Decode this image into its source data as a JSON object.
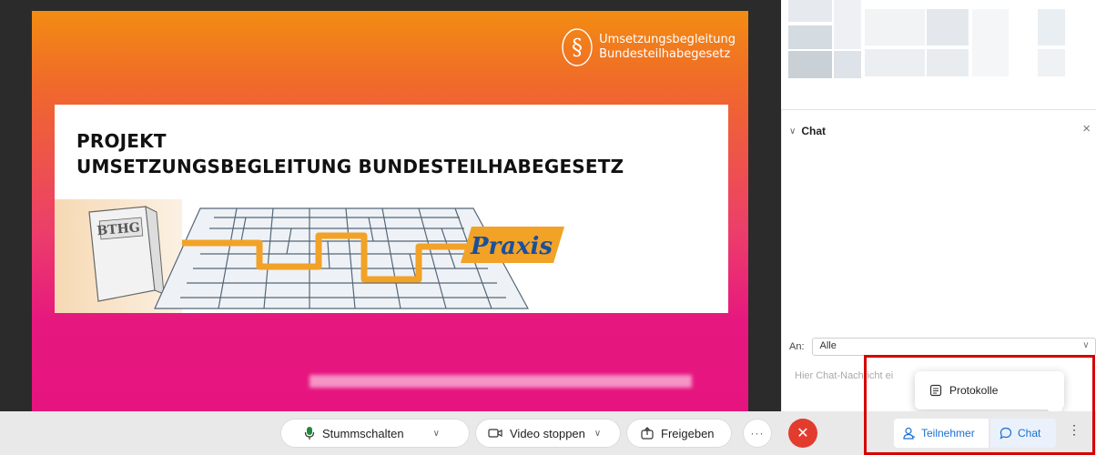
{
  "slide": {
    "logo": {
      "line1": "Umsetzungsbegleitung",
      "line2": "Bundesteilhabegesetz"
    },
    "title_line1": "PROJEKT",
    "title_line2": "UMSETZUNGSBEGLEITUNG BUNDESTEILHABEGESETZ",
    "book_label": "BTHG",
    "banner_label": "Praxis"
  },
  "chat": {
    "title": "Chat",
    "to_label": "An:",
    "to_value": "Alle",
    "input_placeholder": "Hier Chat-Nachricht ei"
  },
  "popup": {
    "item_label": "Protokolle"
  },
  "toolbar": {
    "mute_label": "Stummschalten",
    "video_label": "Video stoppen",
    "share_label": "Freigeben",
    "more_label": "···",
    "participants_label": "Teilnehmer",
    "chat_label": "Chat"
  },
  "colors": {
    "accent_blue": "#1a6fd0",
    "end_red": "#e23c2e",
    "highlight_red": "#d60000",
    "slide_orange": "#f28c12",
    "slide_magenta": "#e6147f"
  },
  "icons": [
    "microphone-icon",
    "video-camera-icon",
    "share-icon",
    "end-call-icon",
    "participants-icon",
    "chat-bubble-icon",
    "kebab-menu-icon",
    "notes-icon",
    "close-icon",
    "chevron-down-icon"
  ]
}
